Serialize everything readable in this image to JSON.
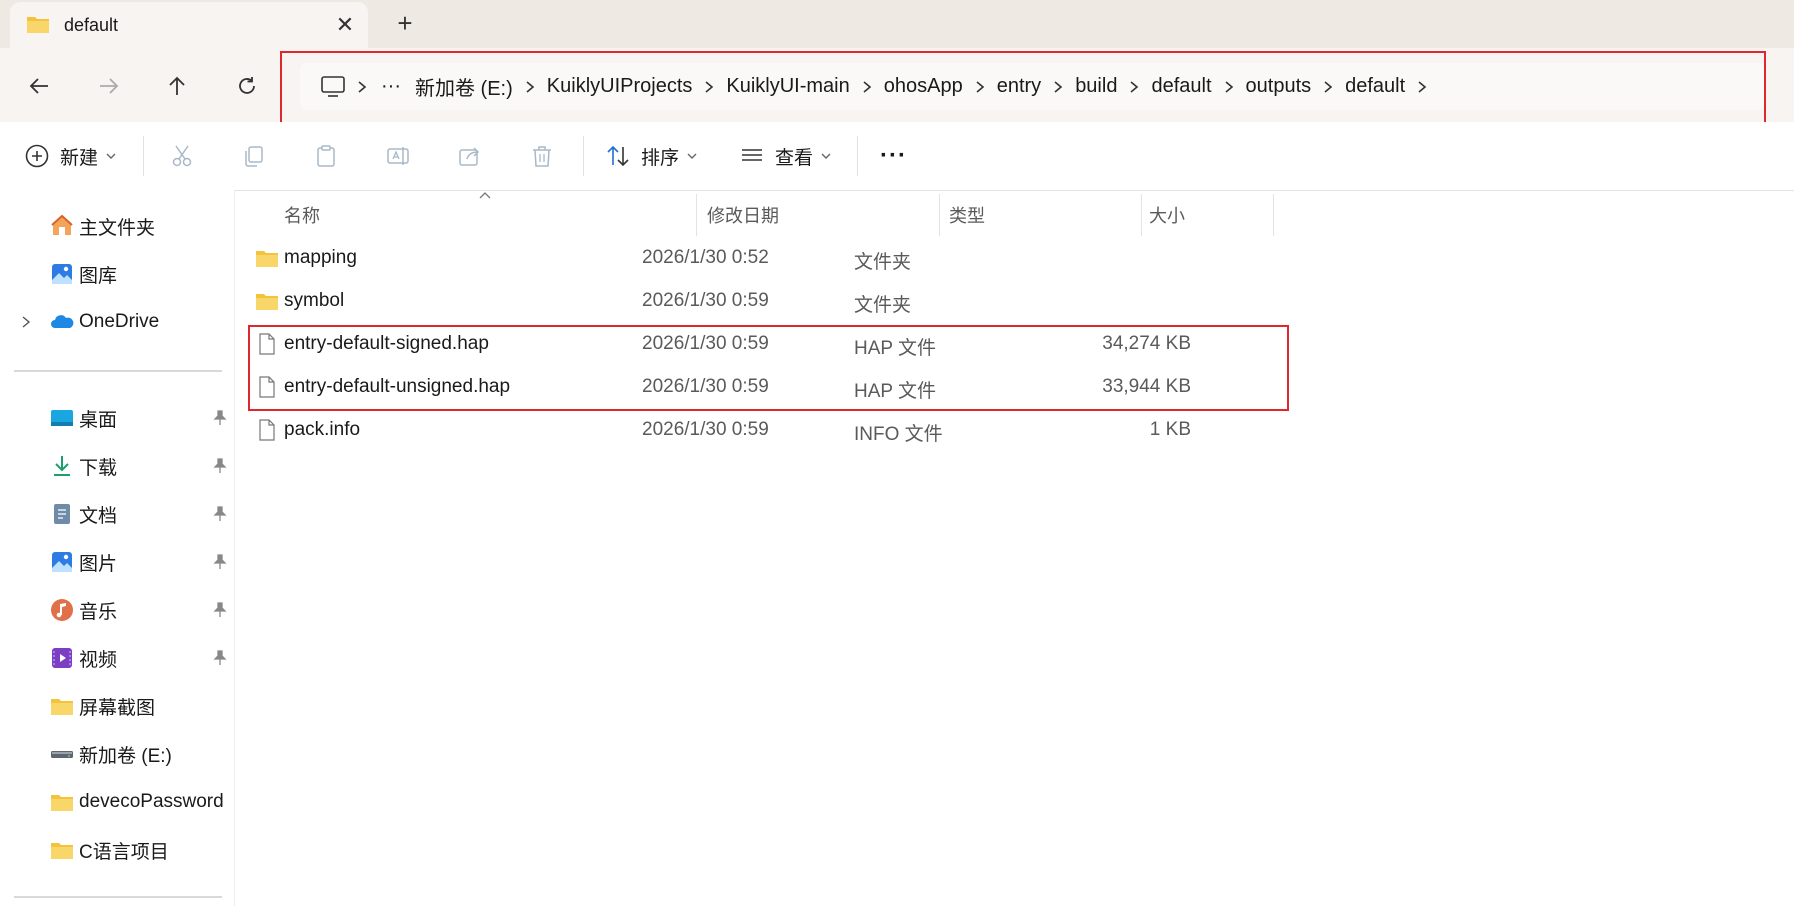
{
  "colors": {
    "highlight_outline": "#e0262e",
    "folder_yellow": "#f5c33b",
    "accent_blue": "#1f6fd6"
  },
  "tab": {
    "title": "default",
    "icon": "folder-icon",
    "close_glyph": "✕",
    "new_tab_glyph": "+"
  },
  "nav": {
    "back": "arrow-left-icon",
    "forward": "arrow-right-icon",
    "up": "arrow-up-icon",
    "refresh": "refresh-icon"
  },
  "address": {
    "device_icon": "computer-icon",
    "overflow": "···",
    "crumbs": [
      "新加卷 (E:)",
      "KuiklyUIProjects",
      "KuiklyUI-main",
      "ohosApp",
      "entry",
      "build",
      "default",
      "outputs",
      "default"
    ]
  },
  "toolbar": {
    "new_label": "新建",
    "sort_label": "排序",
    "view_label": "查看",
    "more_glyph": "···"
  },
  "sidebar": {
    "items": [
      {
        "label": "主文件夹",
        "icon": "home-icon"
      },
      {
        "label": "图库",
        "icon": "gallery-icon"
      },
      {
        "label": "OneDrive",
        "icon": "onedrive-icon"
      },
      {
        "label": "桌面",
        "icon": "desktop-icon"
      },
      {
        "label": "下载",
        "icon": "download-icon"
      },
      {
        "label": "文档",
        "icon": "documents-icon"
      },
      {
        "label": "图片",
        "icon": "pictures-icon"
      },
      {
        "label": "音乐",
        "icon": "music-icon"
      },
      {
        "label": "视频",
        "icon": "videos-icon"
      },
      {
        "label": "屏幕截图",
        "icon": "folder-icon"
      },
      {
        "label": "新加卷 (E:)",
        "icon": "drive-icon"
      },
      {
        "label": "devecoPassword",
        "icon": "folder-icon"
      },
      {
        "label": "C语言项目",
        "icon": "folder-icon"
      }
    ]
  },
  "columns": {
    "name": "名称",
    "modified": "修改日期",
    "type": "类型",
    "size": "大小"
  },
  "files": [
    {
      "name": "mapping",
      "modified": "2026/1/30 0:52",
      "type": "文件夹",
      "size": "",
      "icon": "folder-icon"
    },
    {
      "name": "symbol",
      "modified": "2026/1/30 0:59",
      "type": "文件夹",
      "size": "",
      "icon": "folder-icon"
    },
    {
      "name": "entry-default-signed.hap",
      "modified": "2026/1/30 0:59",
      "type": "HAP 文件",
      "size": "34,274 KB",
      "icon": "file-icon"
    },
    {
      "name": "entry-default-unsigned.hap",
      "modified": "2026/1/30 0:59",
      "type": "HAP 文件",
      "size": "33,944 KB",
      "icon": "file-icon"
    },
    {
      "name": "pack.info",
      "modified": "2026/1/30 0:59",
      "type": "INFO 文件",
      "size": "1 KB",
      "icon": "file-icon"
    }
  ]
}
